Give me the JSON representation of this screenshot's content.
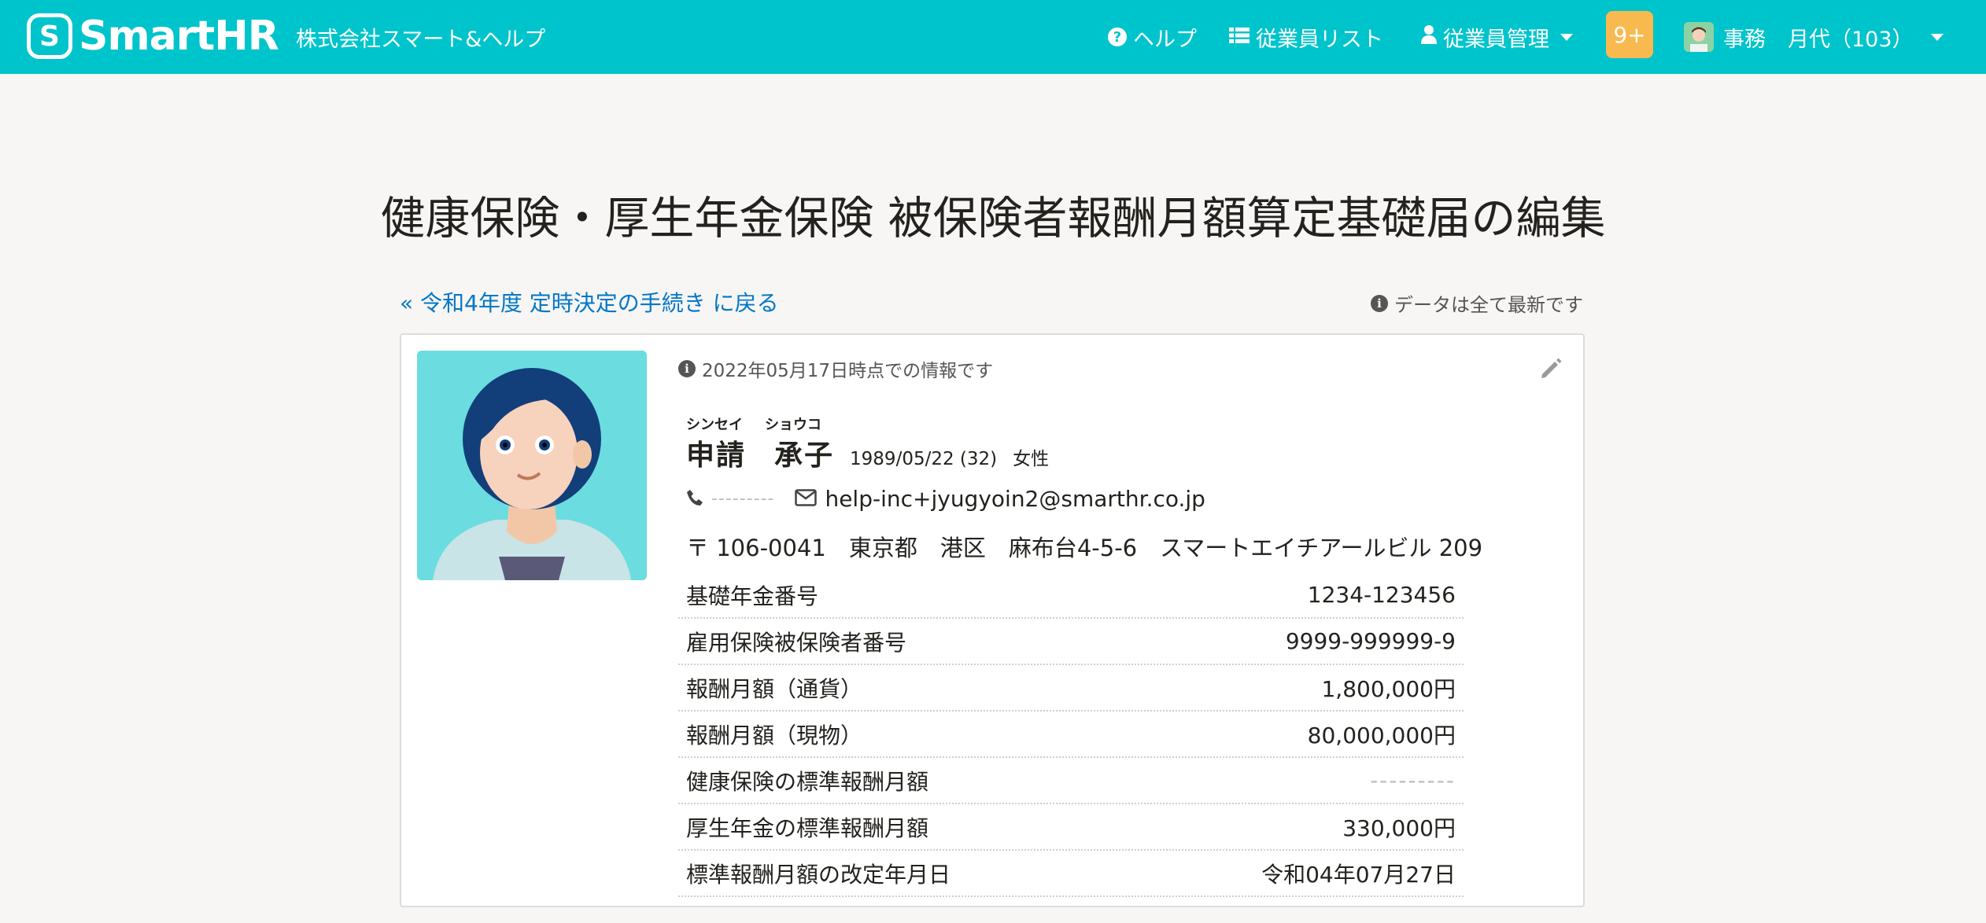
{
  "header": {
    "logo_mark": "S",
    "logo_text": "SmartHR",
    "company": "株式会社スマート&ヘルプ",
    "nav": {
      "help": "ヘルプ",
      "employee_list": "従業員リスト",
      "employee_admin": "従業員管理"
    },
    "notifications_badge": "9+",
    "user_role": "事務",
    "user_name": "月代（103）",
    "brand_color": "#00c4cc",
    "badge_color": "#f8b94e"
  },
  "page": {
    "title": "健康保険・厚生年金保険 被保険者報酬月額算定基礎届の編集",
    "back_link": "« 令和4年度 定時決定の手続き に戻る",
    "status_note": "データは全て最新です"
  },
  "employee": {
    "timestamp_note": "2022年05月17日時点での情報です",
    "ruby_family": "シンセイ",
    "ruby_given": "ショウコ",
    "family_name": "申請",
    "given_name": "承子",
    "birthday": "1989/05/22 (32)",
    "gender": "女性",
    "phone": "---------",
    "email": "help-inc+jyugyoin2@smarthr.co.jp",
    "address": "〒 106-0041　東京都　港区　麻布台4-5-6　スマートエイチアールビル 209"
  },
  "fields": [
    {
      "label": "基礎年金番号",
      "value": "1234-123456"
    },
    {
      "label": "雇用保険被保険者番号",
      "value": "9999-999999-9"
    },
    {
      "label": "報酬月額（通貨）",
      "value": "1,800,000円"
    },
    {
      "label": "報酬月額（現物）",
      "value": "80,000,000円"
    },
    {
      "label": "健康保険の標準報酬月額",
      "value": "---------"
    },
    {
      "label": "厚生年金の標準報酬月額",
      "value": "330,000円"
    },
    {
      "label": "標準報酬月額の改定年月日",
      "value": "令和04年07月27日"
    }
  ]
}
